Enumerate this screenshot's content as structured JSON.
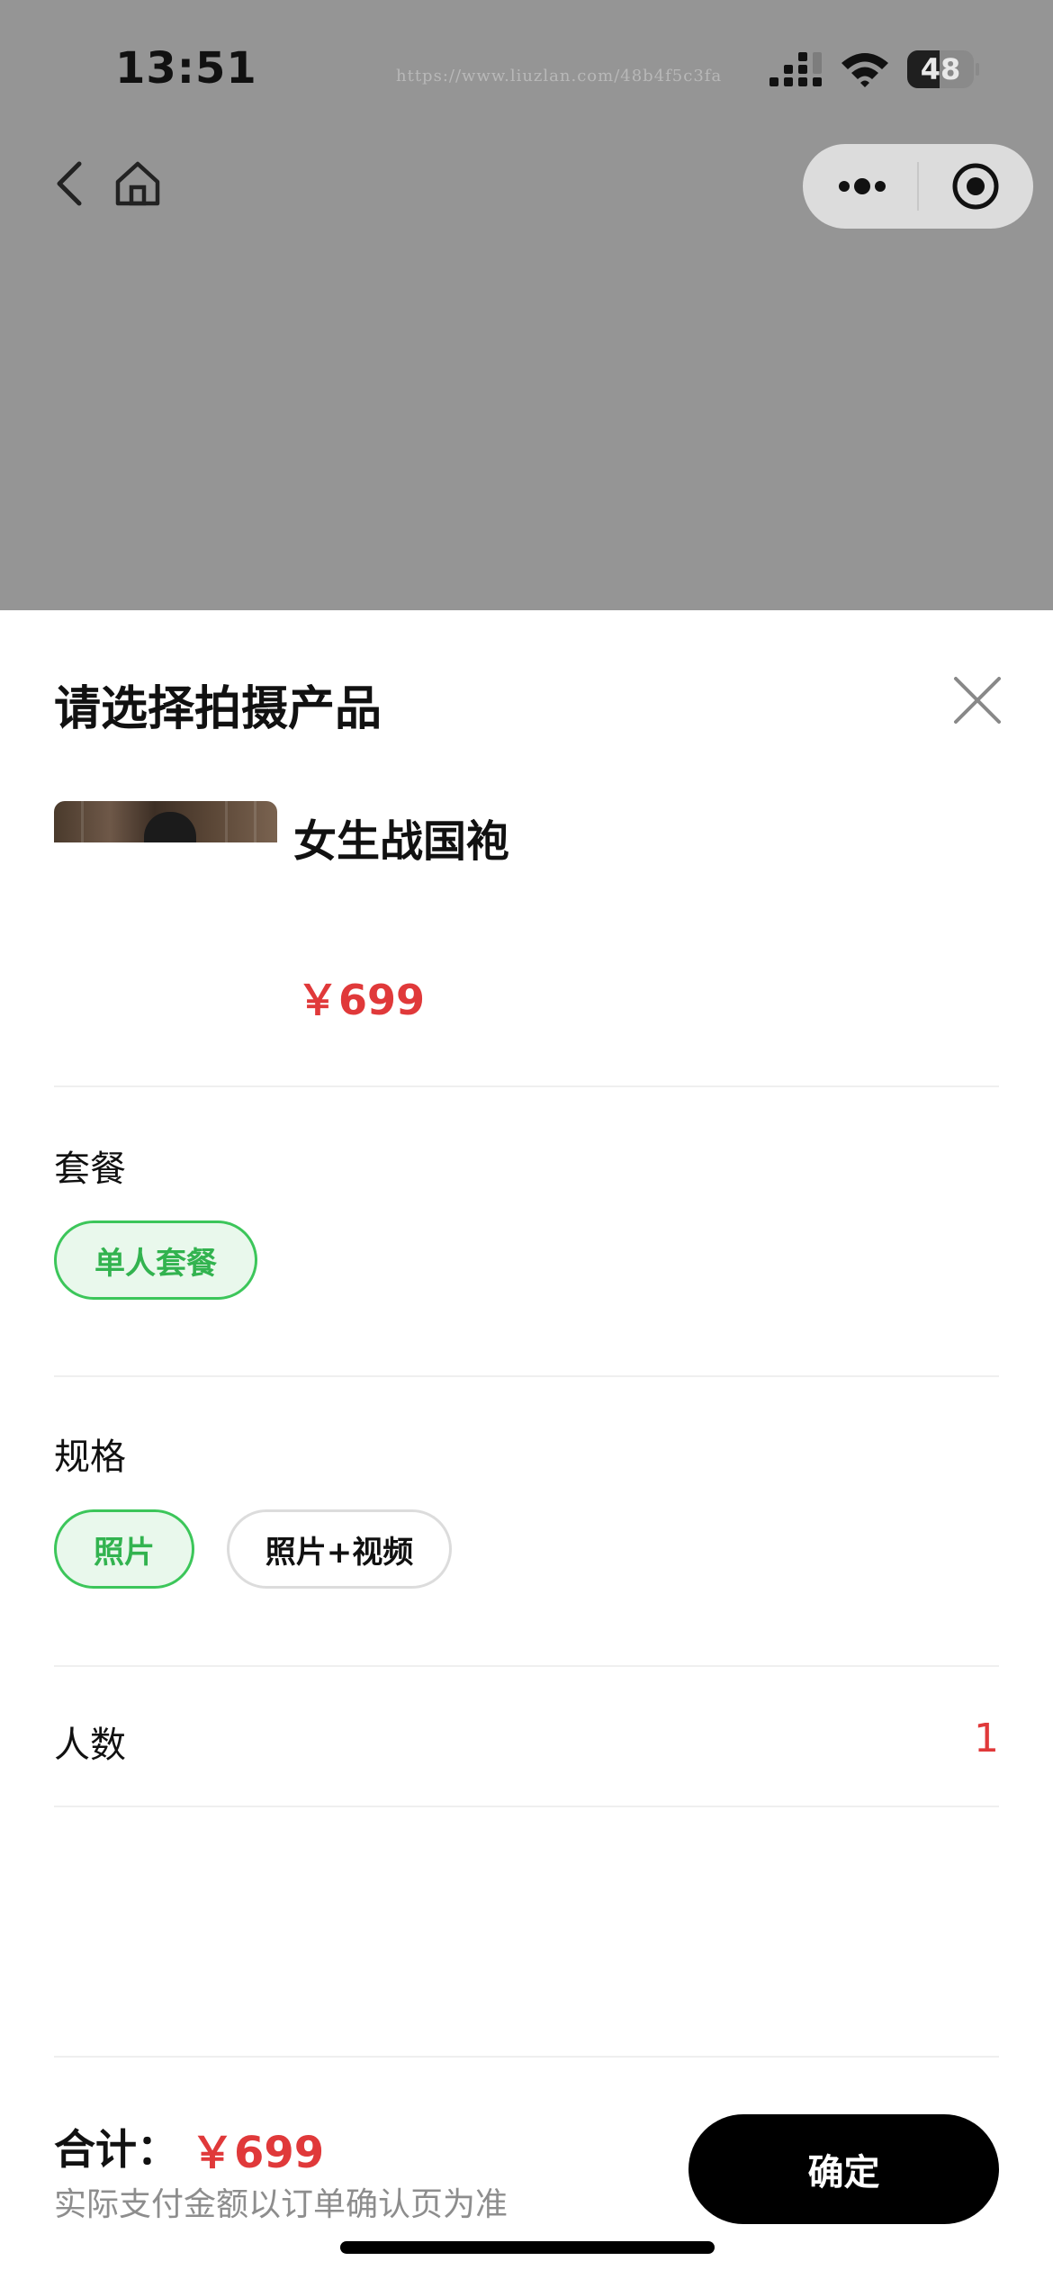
{
  "status_bar": {
    "time": "13:51",
    "battery_level": 48,
    "battery_text": "48",
    "watermark": "https://www.liuzlan.com/48b4f5c3fa"
  },
  "nav": {
    "back_icon": "chevron-left-icon",
    "home_icon": "home-icon",
    "more_icon": "more-dots-icon",
    "target_icon": "target-circle-icon"
  },
  "sheet": {
    "title": "请选择拍摄产品",
    "close_icon": "close-icon"
  },
  "product": {
    "name": "女生战国袍",
    "price": "￥699"
  },
  "package": {
    "label": "套餐",
    "options": [
      {
        "label": "单人套餐",
        "selected": true
      }
    ]
  },
  "spec": {
    "label": "规格",
    "options": [
      {
        "label": "照片",
        "selected": true
      },
      {
        "label": "照片+视频",
        "selected": false
      }
    ]
  },
  "people": {
    "label": "人数",
    "value": "1"
  },
  "footer": {
    "total_label": "合计：",
    "total_price": "￥699",
    "note": "实际支付金额以订单确认页为准",
    "confirm_label": "确定"
  },
  "colors": {
    "accent_red": "#e0393a",
    "selected_green": "#3cc65a",
    "overlay_gray": "#959595"
  }
}
